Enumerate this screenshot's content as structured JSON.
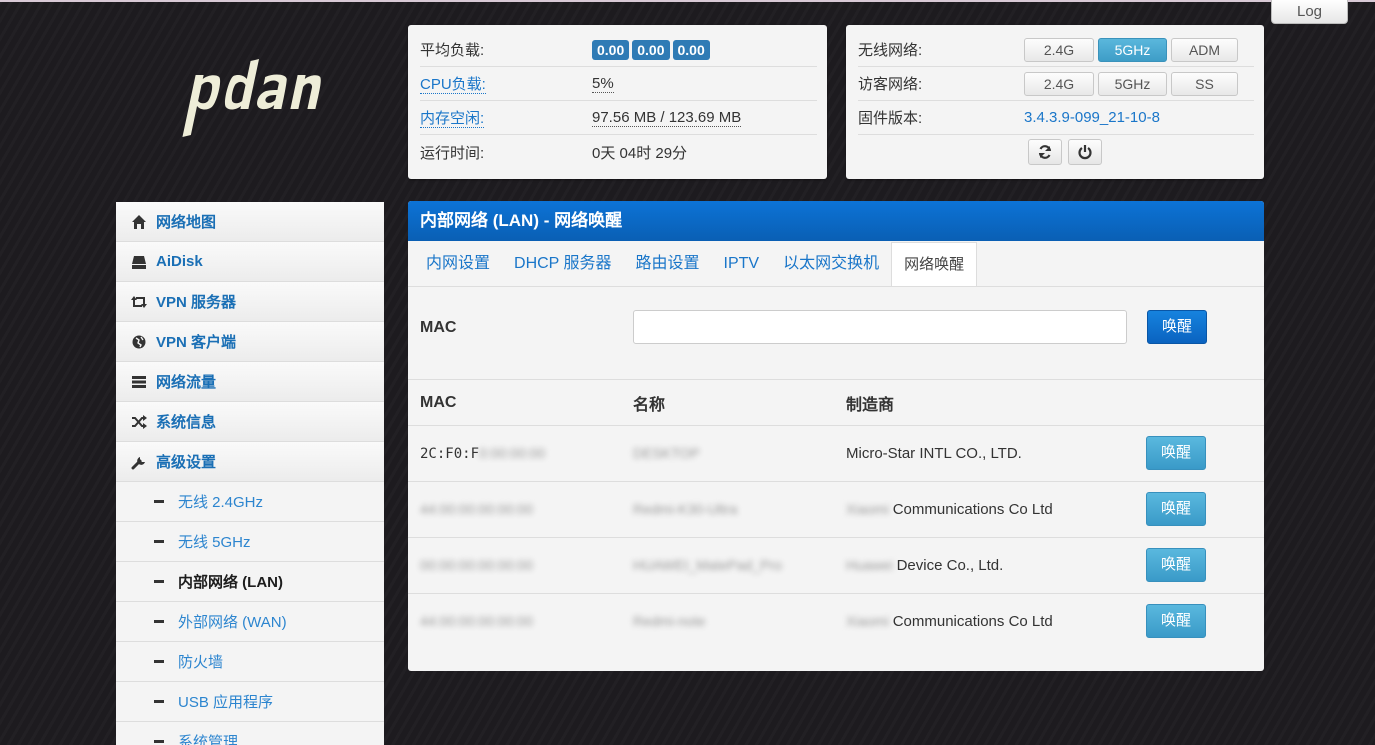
{
  "logout_label": "Log",
  "logo_text": "pdan",
  "status": {
    "load_label": "平均负载:",
    "load_values": [
      "0.00",
      "0.00",
      "0.00"
    ],
    "cpu_label": "CPU负载:",
    "cpu_value": "5%",
    "mem_label": "内存空闲:",
    "mem_value": "97.56 MB / 123.69 MB",
    "uptime_label": "运行时间:",
    "uptime_value": "0天 04时 29分"
  },
  "wireless": {
    "wifi_label": "无线网络:",
    "wifi_buttons": [
      "2.4G",
      "5GHz",
      "ADM"
    ],
    "guest_label": "访客网络:",
    "guest_buttons": [
      "2.4G",
      "5GHz",
      "SS"
    ],
    "fw_label": "固件版本:",
    "fw_value": "3.4.3.9-099_21-10-8"
  },
  "sidebar": {
    "items": [
      {
        "label": "网络地图",
        "icon": "home-icon"
      },
      {
        "label": "AiDisk",
        "icon": "disk-icon"
      },
      {
        "label": "VPN 服务器",
        "icon": "retweet-icon"
      },
      {
        "label": "VPN 客户端",
        "icon": "globe-icon"
      },
      {
        "label": "网络流量",
        "icon": "list-icon"
      },
      {
        "label": "系统信息",
        "icon": "random-icon"
      },
      {
        "label": "高级设置",
        "icon": "wrench-icon"
      }
    ],
    "sub_items": [
      "无线 2.4GHz",
      "无线 5GHz",
      "内部网络 (LAN)",
      "外部网络 (WAN)",
      "防火墙",
      "USB 应用程序",
      "系统管理"
    ]
  },
  "main": {
    "title": "内部网络 (LAN) - 网络唤醒",
    "tabs": [
      "内网设置",
      "DHCP 服务器",
      "路由设置",
      "IPTV",
      "以太网交换机",
      "网络唤醒"
    ],
    "mac_label": "MAC",
    "mac_value": "",
    "wake_label": "唤醒",
    "table_headers": [
      "MAC",
      "名称",
      "制造商"
    ],
    "rows": [
      {
        "mac": "2C:F0:F",
        "mac_hidden": "0:00:00:00",
        "name": "DESKTOP",
        "vendor": "Micro-Star INTL CO., LTD."
      },
      {
        "mac": "",
        "mac_hidden": "44:00:00:00:00:00",
        "name": "Redmi-K30-Ultra",
        "vendor": "Communications Co Ltd",
        "vendor_hidden": "Xiaomi "
      },
      {
        "mac": "",
        "mac_hidden": "00:00:00:00:00:00",
        "name": "HUAWEI_MatePad_Pro",
        "vendor": "Device Co., Ltd.",
        "vendor_hidden": "Huawei "
      },
      {
        "mac": "",
        "mac_hidden": "44:00:00:00:00:00",
        "name": "Redmi-note",
        "vendor": "Communications Co Ltd",
        "vendor_hidden": "Xiaomi "
      }
    ]
  }
}
